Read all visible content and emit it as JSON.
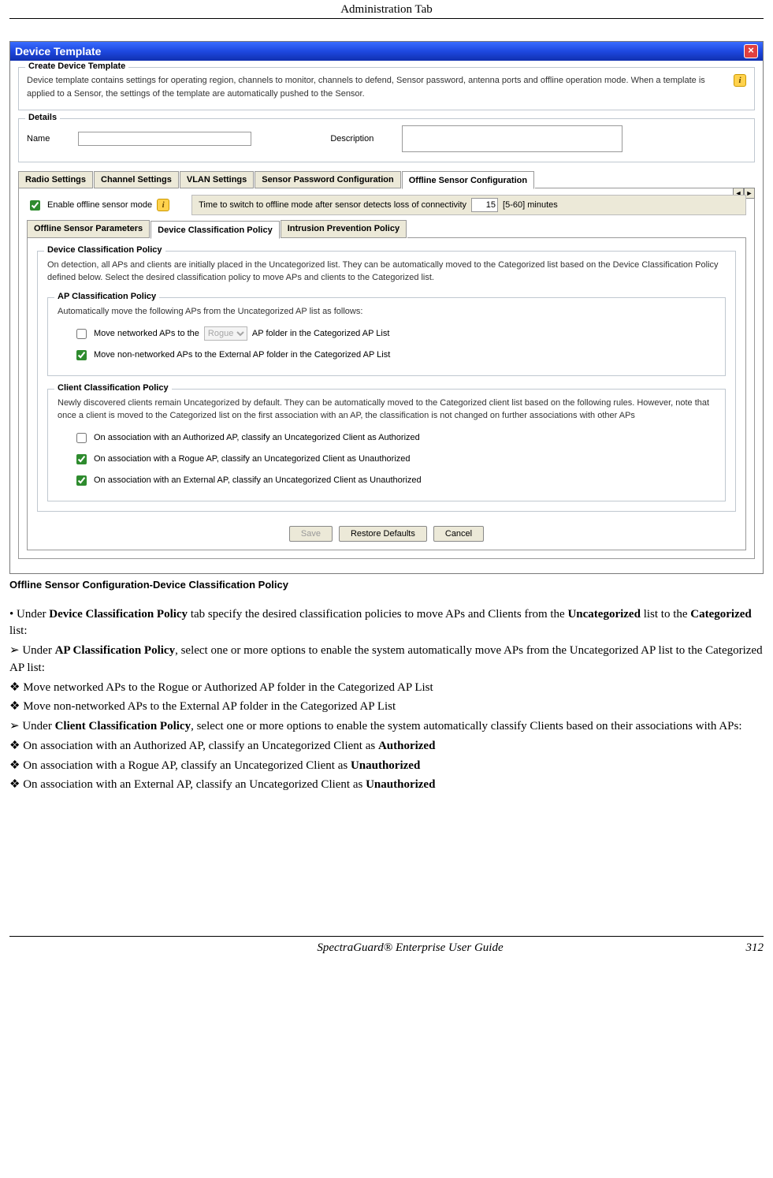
{
  "page": {
    "header": "Administration Tab",
    "footer_center": "SpectraGuard® Enterprise User Guide",
    "footer_right": "312"
  },
  "dialog": {
    "title": "Device Template",
    "create": {
      "legend": "Create Device Template",
      "desc": "Device template contains settings for operating region, channels to monitor, channels to defend, Sensor password, antenna ports and offline operation mode. When a template is applied to a Sensor, the settings of the template are automatically pushed to the Sensor."
    },
    "details": {
      "legend": "Details",
      "name_label": "Name",
      "name_value": "",
      "desc_label": "Description",
      "desc_value": ""
    },
    "tabs_top": [
      "Radio Settings",
      "Channel Settings",
      "VLAN Settings",
      "Sensor Password Configuration",
      "Offline Sensor Configuration"
    ],
    "tabs_top_active": 4,
    "offline": {
      "enable_label": "Enable offline sensor mode",
      "time_label": "Time to switch to offline mode after sensor detects loss of connectivity",
      "time_value": "15",
      "time_range": "[5-60] minutes"
    },
    "tabs_sub": [
      "Offline Sensor Parameters",
      "Device Classification Policy",
      "Intrusion Prevention Policy"
    ],
    "tabs_sub_active": 1,
    "dcp": {
      "legend": "Device Classification Policy",
      "desc": "On detection, all APs and clients are initially placed in the Uncategorized list. They can be automatically moved to the Categorized list based on the Device Classification Policy defined below. Select the desired classification policy to move APs and clients to the Categorized list.",
      "ap_policy": {
        "legend": "AP Classification Policy",
        "intro": "Automatically move the following APs from the Uncategorized AP list as follows:",
        "opt1_pre": "Move networked APs to the",
        "opt1_select": "Rogue",
        "opt1_post": "AP folder in the Categorized AP List",
        "opt1_checked": false,
        "opt2": "Move non-networked APs to the External AP folder in the Categorized AP List",
        "opt2_checked": true
      },
      "client_policy": {
        "legend": "Client Classification Policy",
        "intro": "Newly discovered clients remain Uncategorized by default. They can be automatically moved to the Categorized client list based on the following rules. However, note that once a client is moved to the Categorized list on the first association with an AP, the classification is not changed on further associations with other APs",
        "opt1": "On association with an Authorized AP, classify an Uncategorized Client as Authorized",
        "opt1_checked": false,
        "opt2": "On association with a Rogue AP, classify an Uncategorized Client as Unauthorized",
        "opt2_checked": true,
        "opt3": "On association with an External AP, classify an Uncategorized Client as Unauthorized",
        "opt3_checked": true
      }
    },
    "buttons": {
      "save": "Save",
      "restore": "Restore Defaults",
      "cancel": "Cancel"
    }
  },
  "caption": "Offline Sensor Configuration-Device Classification Policy",
  "doc": {
    "b1_pre": "Under ",
    "b1_bold": "Device Classification Policy",
    "b1_mid": " tab specify the desired classification policies to move APs and Clients from the ",
    "b1_bold2": "Uncategorized",
    "b1_mid2": " list to the ",
    "b1_bold3": "Categorized",
    "b1_post": " list:",
    "b2_pre": "Under ",
    "b2_bold": "AP Classification Policy",
    "b2_post": ", select one or more options to enable the system automatically move APs from the Uncategorized AP list to the Categorized AP list:",
    "b3": "Move networked APs to the Rogue or Authorized AP folder in the Categorized AP List",
    "b4": "Move non-networked APs to the External AP folder in the Categorized AP List",
    "b5_pre": "Under ",
    "b5_bold": "Client Classification Policy",
    "b5_post": ", select one or more options to enable the system automatically classify Clients based on their associations with APs:",
    "b6_pre": "On association with an Authorized AP, classify an Uncategorized Client as ",
    "b6_bold": "Authorized",
    "b7_pre": " On association with a Rogue AP, classify an Uncategorized Client as ",
    "b7_bold": "Unauthorized",
    "b8_pre": " On association with an External AP, classify an Uncategorized Client as ",
    "b8_bold": "Unauthorized"
  }
}
